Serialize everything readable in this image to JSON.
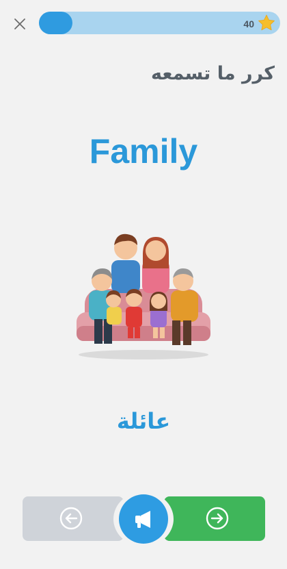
{
  "header": {
    "close_icon": "close-icon",
    "progress_fraction": 0.14,
    "score": "40",
    "star_icon": "star-icon"
  },
  "lesson": {
    "instruction": "كرر ما تسمعه",
    "word_english": "Family",
    "word_arabic": "عائلة"
  },
  "footer": {
    "back_icon": "arrow-left-circle-icon",
    "audio_icon": "megaphone-icon",
    "next_icon": "arrow-right-circle-icon"
  },
  "colors": {
    "accent": "#2b98d9",
    "progress_track": "#a9d4ef",
    "star": "#f6be2c",
    "next_button": "#3fb65a",
    "back_button": "#cfd3d9",
    "background": "#f2f2f2"
  }
}
